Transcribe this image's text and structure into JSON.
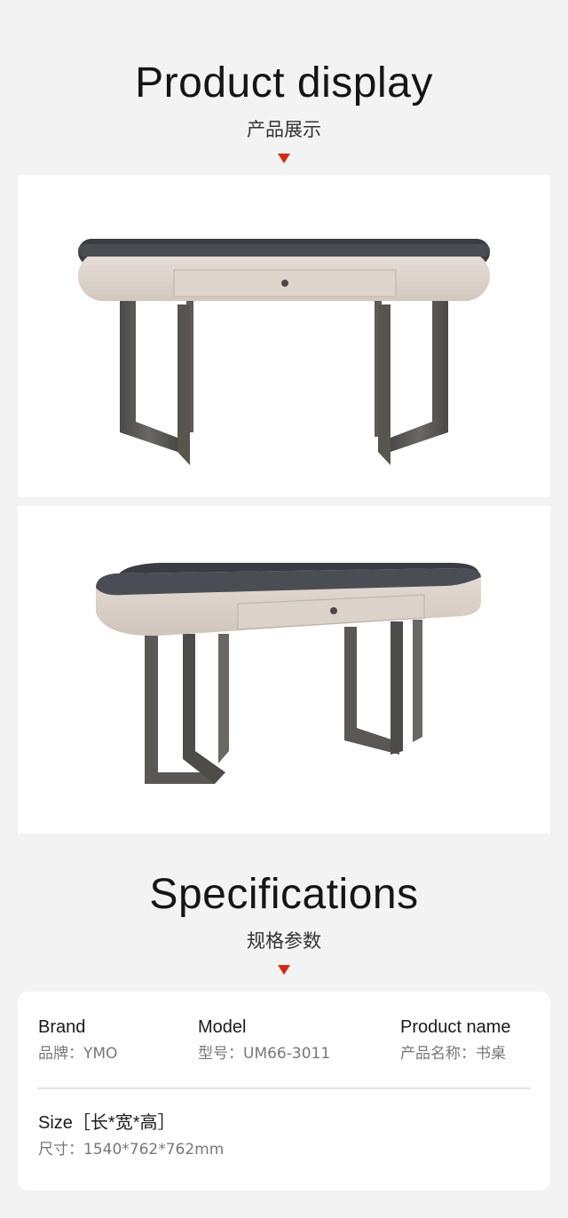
{
  "product_display": {
    "title_en": "Product display",
    "title_cn": "产品展示",
    "arrow_color": "#d42a12"
  },
  "images": [
    {
      "name": "desk-front-view"
    },
    {
      "name": "desk-angle-view"
    }
  ],
  "specifications": {
    "title_en": "Specifications",
    "title_cn": "规格参数",
    "items": [
      {
        "label": "Brand",
        "value": "品牌：YMO"
      },
      {
        "label": "Model",
        "value": "型号：UM66-3011"
      },
      {
        "label": "Product name",
        "value": "产品名称：书桌"
      },
      {
        "label": "Size［长*宽*高］",
        "value": "尺寸：1540*762*762mm"
      }
    ]
  }
}
